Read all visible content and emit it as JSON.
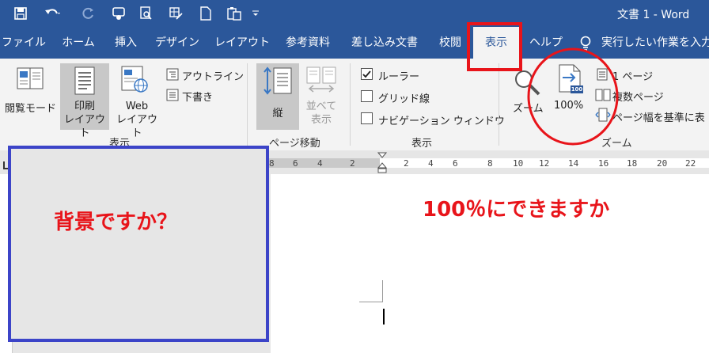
{
  "window": {
    "title": "文書 1  -  Word"
  },
  "tabs": [
    {
      "label": "ファイル"
    },
    {
      "label": "ホーム"
    },
    {
      "label": "挿入"
    },
    {
      "label": "デザイン"
    },
    {
      "label": "レイアウト"
    },
    {
      "label": "参考資料"
    },
    {
      "label": "差し込み文書"
    },
    {
      "label": "校閲"
    },
    {
      "label": "表示",
      "active": true
    },
    {
      "label": "ヘルプ"
    }
  ],
  "tell_me": {
    "placeholder": "実行したい作業を入力"
  },
  "ribbon": {
    "views": {
      "read_mode": "閲覧モード",
      "print_layout": "印刷\nレイアウト",
      "web_layout": "Web\nレイアウト",
      "outline": "アウトライン",
      "draft": "下書き",
      "group_label": "表示"
    },
    "page_movement": {
      "vertical": "縦",
      "side_by_side": "並べて\n表示",
      "group_label": "ページ移動"
    },
    "show": {
      "ruler": "ルーラー",
      "gridlines": "グリッド線",
      "navigation_pane": "ナビゲーション ウィンドウ",
      "ruler_checked": true,
      "gridlines_checked": false,
      "navigation_checked": false,
      "group_label": "表示"
    },
    "zoom": {
      "zoom": "ズーム",
      "hundred_percent": "100%",
      "icon_badge": "100",
      "one_page": "1 ページ",
      "multiple_pages": "複数ページ",
      "page_width": "ページ幅を基準に表",
      "group_label": "ズーム"
    }
  },
  "ruler": {
    "labels": [
      "8",
      "6",
      "4",
      "2",
      "2",
      "4",
      "6",
      "8",
      "10",
      "12",
      "14",
      "16",
      "18",
      "20",
      "22"
    ]
  },
  "annotations": {
    "background_question": "背景ですか？",
    "hundred_question": "100％にできますか"
  },
  "colors": {
    "title_blue": "#2b579a",
    "annotation_red": "#e8141a",
    "annotation_blue": "#3c44c8"
  }
}
